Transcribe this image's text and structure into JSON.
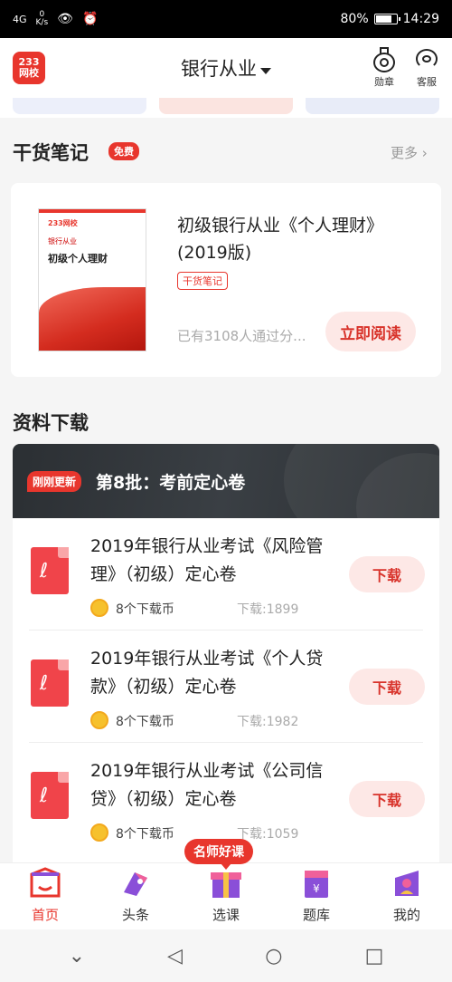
{
  "status_bar": {
    "signal": "4G",
    "net_speed_value": "0",
    "net_speed_unit": "K/s",
    "battery": "80%",
    "battery_level": 0.8,
    "time": "14:29"
  },
  "header": {
    "logo_line1": "233",
    "logo_line2": "网校",
    "title": "银行从业",
    "medal_label": "勋章",
    "service_label": "客服"
  },
  "notes_section": {
    "title": "干货笔记",
    "badge": "免费",
    "more": "更多",
    "card": {
      "cover_logo": "233网校",
      "cover_sub": "银行从业",
      "cover_title": "初级个人理财",
      "title": "初级银行从业《个人理财》(2019版)",
      "tag": "干货笔记",
      "passed": "已有3108人通过分...",
      "read_button": "立即阅读"
    }
  },
  "download_section": {
    "title": "资料下载",
    "banner_badge": "刚刚更新",
    "banner_title": "第8批：考前定心卷",
    "items": [
      {
        "title": "2019年银行从业考试《风险管理》（初级）定心卷",
        "coins": "8个下载币",
        "downloads": "下载:1899",
        "button": "下载"
      },
      {
        "title": "2019年银行从业考试《个人贷款》（初级）定心卷",
        "coins": "8个下载币",
        "downloads": "下载:1982",
        "button": "下载"
      },
      {
        "title": "2019年银行从业考试《公司信贷》（初级）定心卷",
        "coins": "8个下载币",
        "downloads": "下载:1059",
        "button": "下载"
      }
    ]
  },
  "famous_badge": "名师好课",
  "bottom_nav": {
    "items": [
      {
        "label": "首页",
        "icon": "home-icon"
      },
      {
        "label": "头条",
        "icon": "headline-icon"
      },
      {
        "label": "选课",
        "icon": "course-icon"
      },
      {
        "label": "题库",
        "icon": "question-bank-icon"
      },
      {
        "label": "我的",
        "icon": "profile-icon"
      }
    ]
  },
  "colors": {
    "accent": "#e8362d",
    "button_bg": "#fde8e6"
  }
}
